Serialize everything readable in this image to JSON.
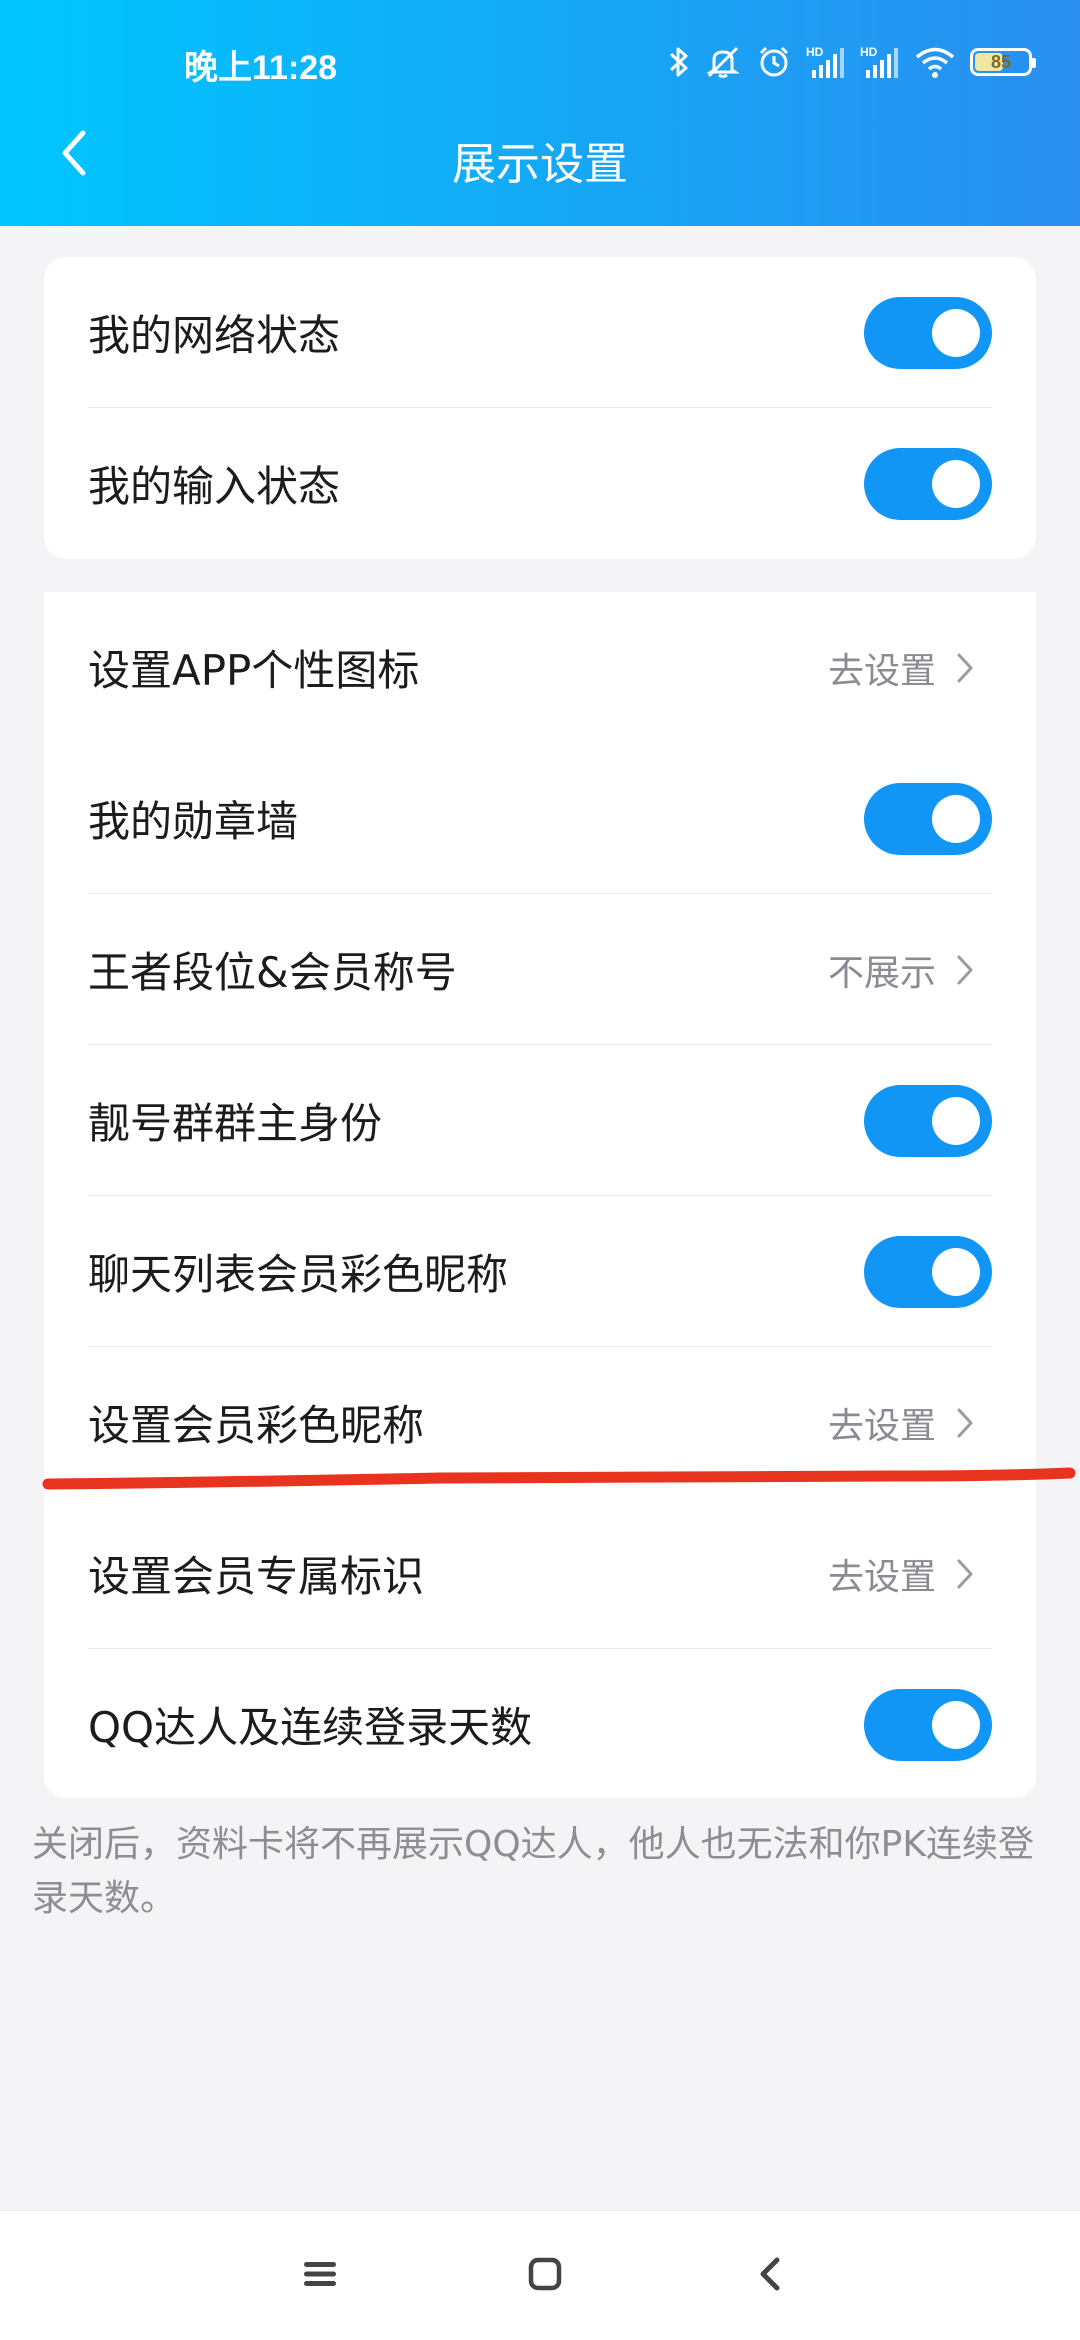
{
  "status_bar": {
    "time": "晚上11:28",
    "battery_level": "85",
    "icons": [
      "bluetooth-icon",
      "mute-icon",
      "alarm-icon",
      "hd-signal-icon",
      "hd-signal-icon",
      "wifi-icon",
      "battery-icon"
    ]
  },
  "header": {
    "title": "展示设置",
    "back_icon": "chevron-left-icon",
    "gradient_start": "#00c6ff",
    "gradient_end": "#2a8ff0"
  },
  "settings": {
    "network_status": {
      "label": "我的网络状态",
      "enabled": true
    },
    "input_status": {
      "label": "我的输入状态",
      "enabled": true
    },
    "app_icon": {
      "label": "设置APP个性图标",
      "value": "去设置"
    },
    "medal_wall": {
      "label": "我的勋章墙",
      "enabled": true
    },
    "rank_title": {
      "label": "王者段位&会员称号",
      "value": "不展示"
    },
    "group_owner": {
      "label": "靓号群群主身份",
      "enabled": true
    },
    "color_nickname_list": {
      "label": "聊天列表会员彩色昵称",
      "enabled": true
    },
    "set_color_nickname": {
      "label": "设置会员彩色昵称",
      "value": "去设置"
    },
    "vip_badge": {
      "label": "设置会员专属标识",
      "value": "去设置"
    },
    "qq_master": {
      "label": "QQ达人及连续登录天数",
      "enabled": true
    }
  },
  "footer_note": "关闭后，资料卡将不再展示QQ达人，他人也无法和你PK连续登录天数。",
  "nav_bar": {
    "icons": [
      "menu-icon",
      "home-icon",
      "back-icon"
    ]
  },
  "colors": {
    "accent": "#1296f6",
    "annotation": "#e8331e"
  }
}
